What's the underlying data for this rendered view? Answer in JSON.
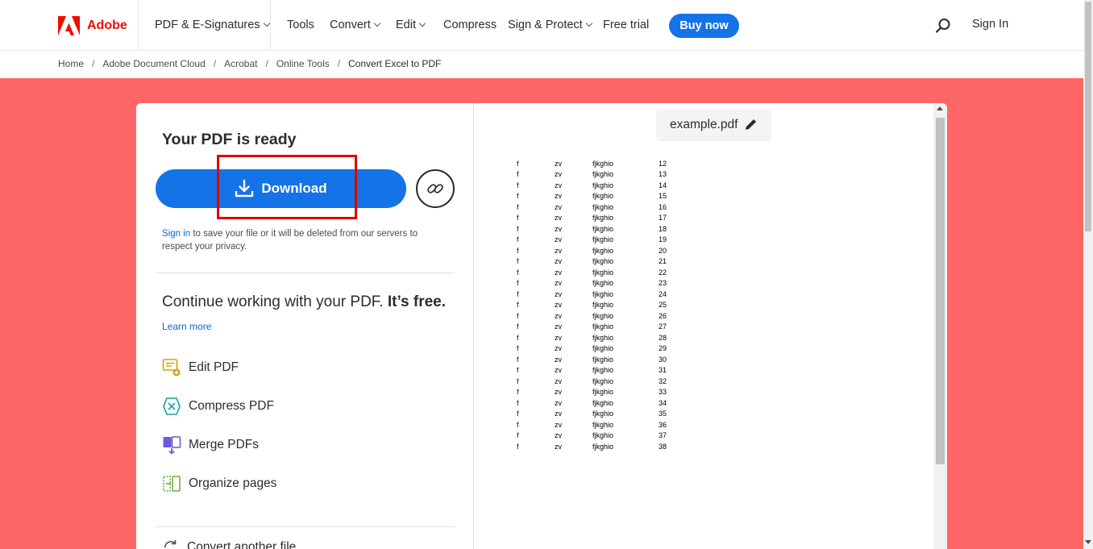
{
  "header": {
    "brand": "Adobe",
    "nav": [
      {
        "label": "PDF & E-Signatures",
        "dropdown": true
      },
      {
        "label": "Tools",
        "dropdown": false
      },
      {
        "label": "Convert",
        "dropdown": true
      },
      {
        "label": "Edit",
        "dropdown": true
      },
      {
        "label": "Compress",
        "dropdown": false
      },
      {
        "label": "Sign & Protect",
        "dropdown": true
      },
      {
        "label": "Free trial",
        "dropdown": false
      }
    ],
    "buy_now": "Buy now",
    "sign_in": "Sign In"
  },
  "breadcrumb": [
    "Home",
    "Adobe Document Cloud",
    "Acrobat",
    "Online Tools",
    "Convert Excel to PDF"
  ],
  "panel": {
    "ready_title": "Your PDF is ready",
    "download_label": "Download",
    "sign_in_link": "Sign in",
    "sign_in_note": " to save your file or it will be deleted from our servers to respect your privacy.",
    "continue_text": "Continue working with your PDF.",
    "continue_bold": "It’s free.",
    "learn_more": "Learn more",
    "tools": [
      {
        "label": "Edit PDF",
        "icon": "edit-pdf-icon"
      },
      {
        "label": "Compress PDF",
        "icon": "compress-pdf-icon"
      },
      {
        "label": "Merge PDFs",
        "icon": "merge-pdfs-icon"
      },
      {
        "label": "Organize pages",
        "icon": "organize-pages-icon"
      }
    ],
    "convert_another": "Convert another file"
  },
  "preview": {
    "filename": "example.pdf",
    "rows": [
      [
        "f",
        "zv",
        "fjkghio",
        "12"
      ],
      [
        "f",
        "zv",
        "fjkghio",
        "13"
      ],
      [
        "f",
        "zv",
        "fjkghio",
        "14"
      ],
      [
        "f",
        "zv",
        "fjkghio",
        "15"
      ],
      [
        "f",
        "zv",
        "fjkghio",
        "16"
      ],
      [
        "f",
        "zv",
        "fjkghio",
        "17"
      ],
      [
        "f",
        "zv",
        "fjkghio",
        "18"
      ],
      [
        "f",
        "zv",
        "fjkghio",
        "19"
      ],
      [
        "f",
        "zv",
        "fjkghio",
        "20"
      ],
      [
        "f",
        "zv",
        "fjkghio",
        "21"
      ],
      [
        "f",
        "zv",
        "fjkghio",
        "22"
      ],
      [
        "f",
        "zv",
        "fjkghio",
        "23"
      ],
      [
        "f",
        "zv",
        "fjkghio",
        "24"
      ],
      [
        "f",
        "zv",
        "fjkghio",
        "25"
      ],
      [
        "f",
        "zv",
        "fjkghio",
        "26"
      ],
      [
        "f",
        "zv",
        "fjkghio",
        "27"
      ],
      [
        "f",
        "zv",
        "fjkghio",
        "28"
      ],
      [
        "f",
        "zv",
        "fjkghio",
        "29"
      ],
      [
        "f",
        "zv",
        "fjkghio",
        "30"
      ],
      [
        "f",
        "zv",
        "fjkghio",
        "31"
      ],
      [
        "f",
        "zv",
        "fjkghio",
        "32"
      ],
      [
        "f",
        "zv",
        "fjkghio",
        "33"
      ],
      [
        "f",
        "zv",
        "fjkghio",
        "34"
      ],
      [
        "f",
        "zv",
        "fjkghio",
        "35"
      ],
      [
        "f",
        "zv",
        "fjkghio",
        "36"
      ],
      [
        "f",
        "zv",
        "fjkghio",
        "37"
      ],
      [
        "f",
        "zv",
        "fjkghio",
        "38"
      ]
    ]
  },
  "colors": {
    "brand_red": "#eb1000",
    "accent_blue": "#1473e6",
    "band": "#ff6666",
    "highlight": "#e00000"
  }
}
